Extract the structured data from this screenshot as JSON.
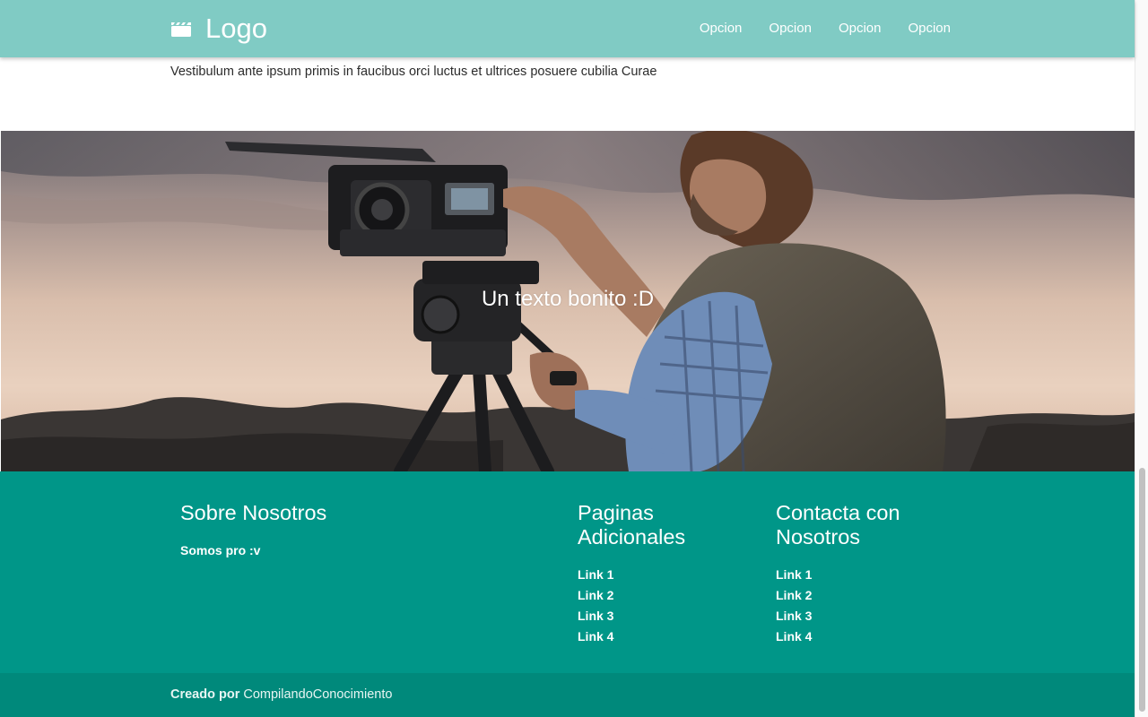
{
  "navbar": {
    "brand_icon": "clapperboard-icon",
    "brand_label": "Logo",
    "menu": [
      {
        "label": "Opcion"
      },
      {
        "label": "Opcion"
      },
      {
        "label": "Opcion"
      },
      {
        "label": "Opcion"
      }
    ],
    "background_color": "#80cbc4"
  },
  "intro": {
    "text": "Vestibulum ante ipsum primis in faucibus orci luctus et ultrices posuere cubilia Curae"
  },
  "hero": {
    "image": "videographer-with-cinema-camera-on-tripod",
    "caption": "Un texto bonito :D"
  },
  "footer": {
    "background_color": "#009688",
    "about": {
      "title": "Sobre Nosotros",
      "text": "Somos pro :v"
    },
    "pages": {
      "title": "Paginas Adicionales",
      "links": [
        "Link 1",
        "Link 2",
        "Link 3",
        "Link 4"
      ]
    },
    "contact": {
      "title": "Contacta con Nosotros",
      "links": [
        "Link 1",
        "Link 2",
        "Link 3",
        "Link 4"
      ]
    },
    "copyright": {
      "prefix": "Creado por",
      "author": "CompilandoConocimiento",
      "background_color": "#00897b"
    }
  }
}
